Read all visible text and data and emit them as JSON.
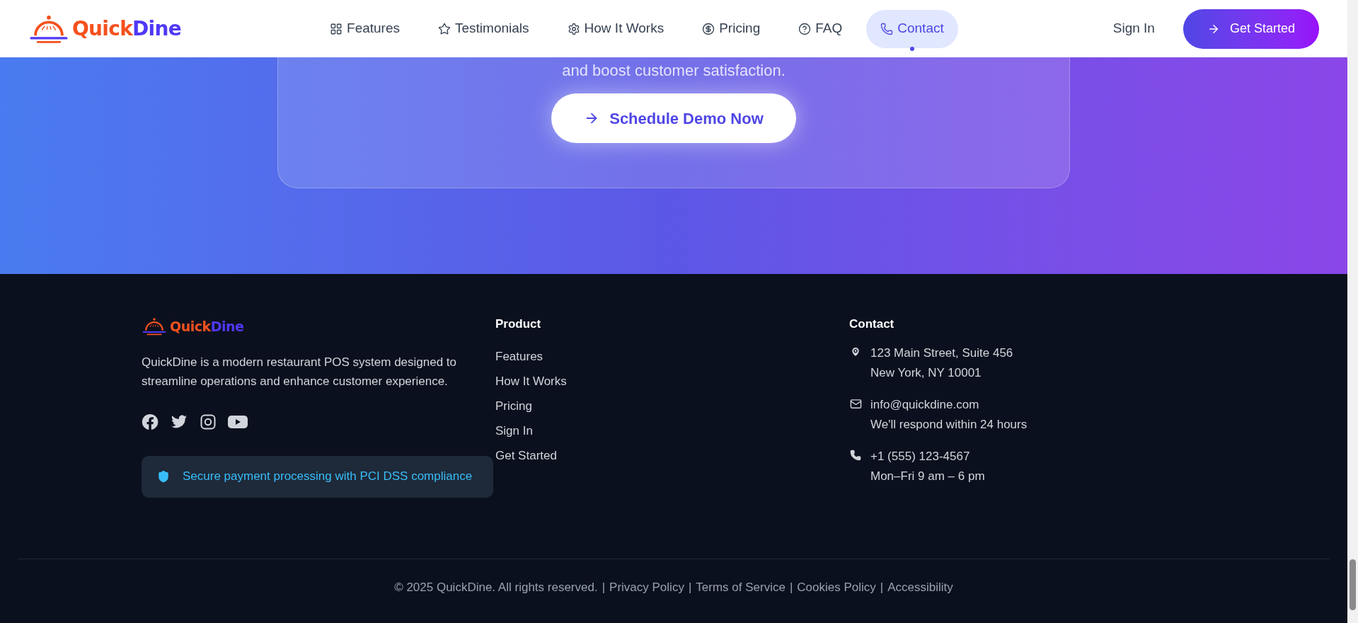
{
  "header": {
    "logo": {
      "part_1": "Quick",
      "part_2": "Dine"
    },
    "nav": [
      {
        "label": "Features",
        "kind": "grid",
        "selected": false
      },
      {
        "label": "Testimonials",
        "kind": "star",
        "selected": false
      },
      {
        "label": "How It Works",
        "kind": "gear",
        "selected": false
      },
      {
        "label": "Pricing",
        "kind": "dollar",
        "selected": false
      },
      {
        "label": "FAQ",
        "kind": "help",
        "selected": false
      },
      {
        "label": "Contact",
        "kind": "phone",
        "selected": true
      }
    ],
    "sign_in": "Sign In",
    "cta": "Get Started"
  },
  "hero": {
    "subtitle": "and boost customer satisfaction.",
    "button": "Schedule Demo Now"
  },
  "footer": {
    "logo": {
      "part_1": "Quick",
      "part_2": "Dine"
    },
    "description": "QuickDine is a modern restaurant POS system designed to streamline operations and enhance customer experience.",
    "social": [
      {
        "kind": "facebook"
      },
      {
        "kind": "twitter"
      },
      {
        "kind": "instagram"
      },
      {
        "kind": "youtube"
      }
    ],
    "security_note": "Secure payment processing with PCI DSS compliance",
    "product": {
      "title": "Product",
      "links": [
        "Features",
        "How It Works",
        "Pricing",
        "Sign In",
        "Get Started"
      ]
    },
    "contact": {
      "title": "Contact",
      "items": [
        {
          "kind": "address",
          "lines": [
            "123 Main Street, Suite 456",
            "New York, NY 10001"
          ]
        },
        {
          "kind": "email",
          "lines": [
            "info@quickdine.com",
            "We'll respond within 24 hours"
          ]
        },
        {
          "kind": "phone",
          "lines": [
            "+1 (555) 123-4567",
            "Mon–Fri 9 am – 6 pm"
          ]
        }
      ]
    },
    "copyright": "© 2025 QuickDine. All rights reserved.",
    "legal_links": [
      {
        "separator": "|",
        "text": "Privacy Policy"
      },
      {
        "separator": "|",
        "text": "Terms of Service"
      },
      {
        "separator": "|",
        "text": "Cookies Policy"
      },
      {
        "separator": "|",
        "text": "Accessibility"
      }
    ]
  }
}
